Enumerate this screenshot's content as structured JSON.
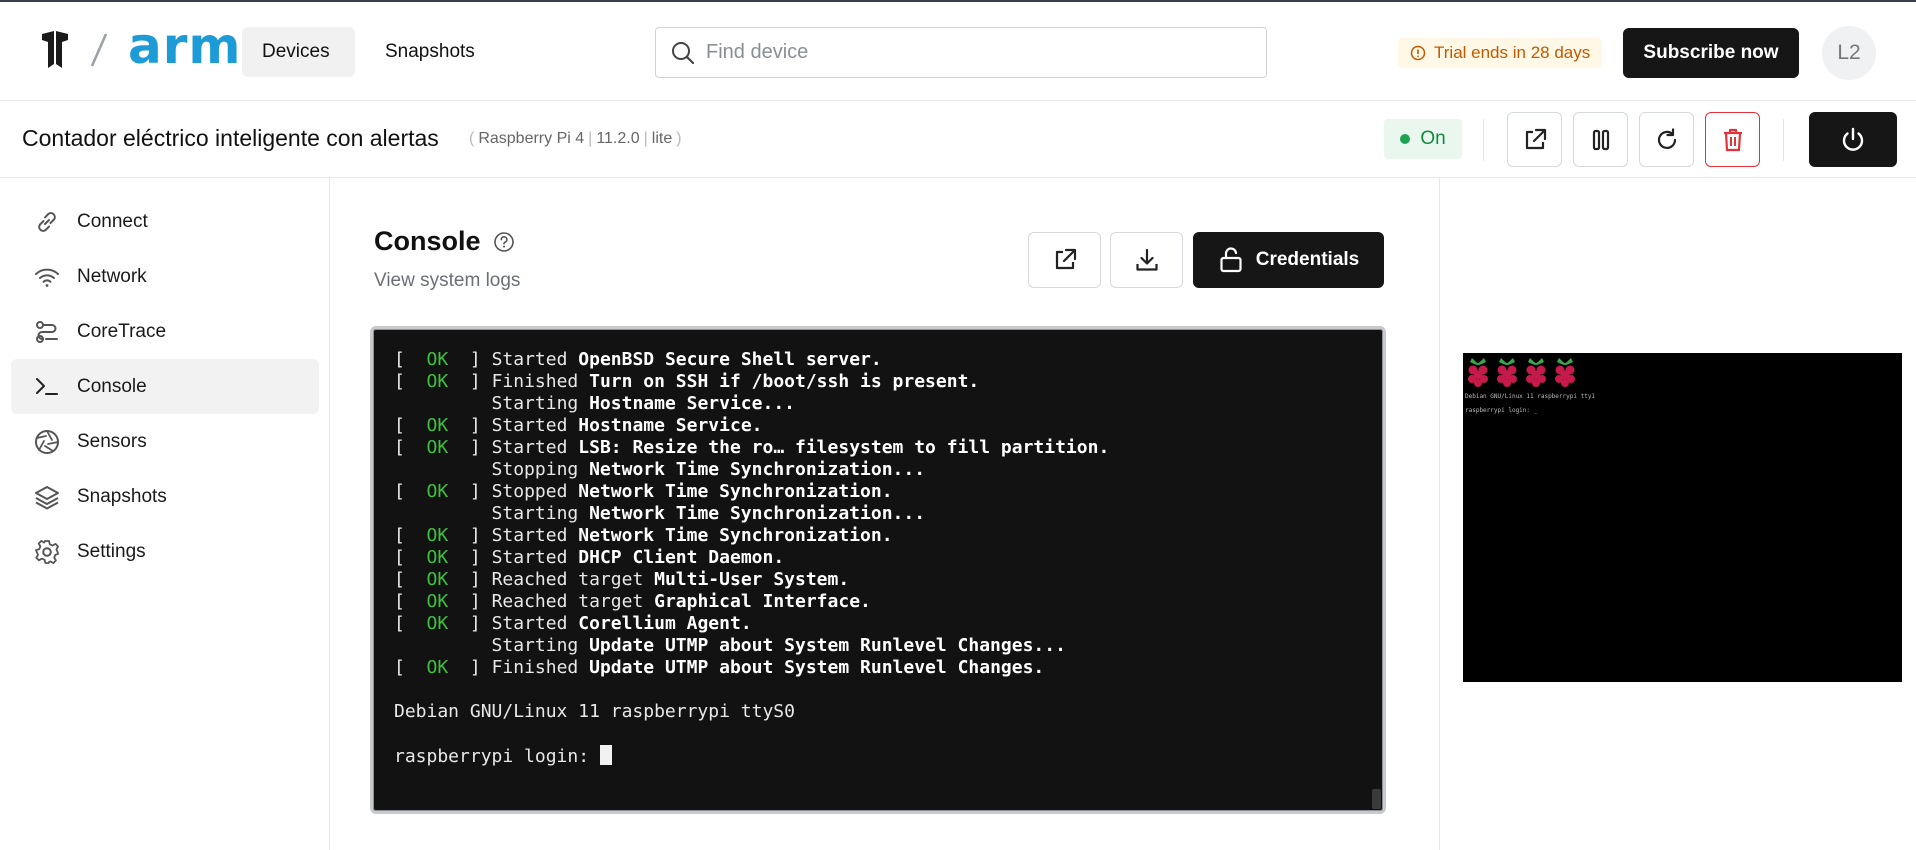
{
  "brand": {
    "name": "arm",
    "color": "#1d9bd7"
  },
  "nav": {
    "devices": "Devices",
    "snapshots": "Snapshots"
  },
  "search": {
    "placeholder": "Find device"
  },
  "trial": {
    "text": "Trial ends in 28 days"
  },
  "subscribe": {
    "label": "Subscribe now"
  },
  "user": {
    "initials": "L2"
  },
  "device": {
    "name": "Contador eléctrico inteligente con alertas",
    "model": "Raspberry Pi 4",
    "version": "11.2.0",
    "flavor": "lite",
    "status": "On"
  },
  "sidebar": {
    "items": [
      {
        "label": "Connect",
        "icon": "link-icon"
      },
      {
        "label": "Network",
        "icon": "wifi-icon"
      },
      {
        "label": "CoreTrace",
        "icon": "coretrace-icon"
      },
      {
        "label": "Console",
        "icon": "terminal-icon"
      },
      {
        "label": "Sensors",
        "icon": "aperture-icon"
      },
      {
        "label": "Snapshots",
        "icon": "layers-icon"
      },
      {
        "label": "Settings",
        "icon": "gear-icon"
      }
    ],
    "active": "Console"
  },
  "console": {
    "title": "Console",
    "subtitle": "View system logs",
    "credentials_label": "Credentials",
    "lines": [
      {
        "ok": true,
        "verb": "Started",
        "target": "OpenBSD Secure Shell server",
        "suffix": "."
      },
      {
        "ok": true,
        "verb": "Finished",
        "target": "Turn on SSH if /boot/ssh is present",
        "suffix": "."
      },
      {
        "ok": false,
        "verb": "Starting",
        "target": "Hostname Service",
        "suffix": "..."
      },
      {
        "ok": true,
        "verb": "Started",
        "target": "Hostname Service",
        "suffix": "."
      },
      {
        "ok": true,
        "verb": "Started",
        "target": "LSB: Resize the ro… filesystem to fill partition",
        "suffix": "."
      },
      {
        "ok": false,
        "verb": "Stopping",
        "target": "Network Time Synchronization",
        "suffix": "..."
      },
      {
        "ok": true,
        "verb": "Stopped",
        "target": "Network Time Synchronization",
        "suffix": "."
      },
      {
        "ok": false,
        "verb": "Starting",
        "target": "Network Time Synchronization",
        "suffix": "..."
      },
      {
        "ok": true,
        "verb": "Started",
        "target": "Network Time Synchronization",
        "suffix": "."
      },
      {
        "ok": true,
        "verb": "Started",
        "target": "DHCP Client Daemon",
        "suffix": "."
      },
      {
        "ok": true,
        "verb": "Reached target",
        "target": "Multi-User System",
        "suffix": "."
      },
      {
        "ok": true,
        "verb": "Reached target",
        "target": "Graphical Interface",
        "suffix": "."
      },
      {
        "ok": true,
        "verb": "Started",
        "target": "Corellium Agent",
        "suffix": "."
      },
      {
        "ok": false,
        "verb": "Starting",
        "target": "Update UTMP about System Runlevel Changes",
        "suffix": "..."
      },
      {
        "ok": true,
        "verb": "Finished",
        "target": "Update UTMP about System Runlevel Changes",
        "suffix": "."
      }
    ],
    "ok_text": "OK",
    "banner": "Debian GNU/Linux 11 raspberrypi ttyS0",
    "prompt": "raspberrypi login: "
  },
  "preview": {
    "line1": "Debian GNU/Linux 11 raspberrypi tty1",
    "line2": "raspberrypi login: _"
  },
  "colors": {
    "ok_green": "#3ec13e",
    "danger": "#e2323a",
    "status_green": "#1ea352",
    "trial_orange": "#c05a00"
  }
}
